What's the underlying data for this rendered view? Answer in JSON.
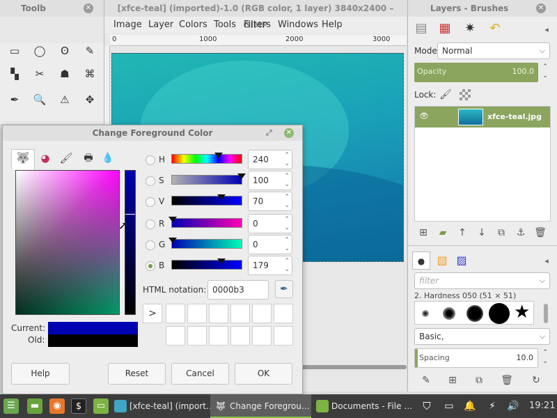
{
  "toolbox": {
    "title": "Toolb",
    "tools": [
      {
        "icon": "rect-select-icon",
        "glyph": "▭"
      },
      {
        "icon": "ellipse-select-icon",
        "glyph": "◯"
      },
      {
        "icon": "lasso-select-icon",
        "glyph": "ʘ"
      },
      {
        "icon": "fuzzy-select-icon",
        "glyph": "✎"
      },
      {
        "icon": "color-select-icon",
        "glyph": "▚"
      },
      {
        "icon": "scissors-select-icon",
        "glyph": "✂"
      },
      {
        "icon": "foreground-select-icon",
        "glyph": "☗"
      },
      {
        "icon": "paths-tool-icon",
        "glyph": "⌘"
      },
      {
        "icon": "color-picker-icon",
        "glyph": "✒"
      },
      {
        "icon": "zoom-tool-icon",
        "glyph": "🔍"
      },
      {
        "icon": "measure-tool-icon",
        "glyph": "⚠"
      },
      {
        "icon": "move-tool-icon",
        "glyph": "✥"
      }
    ]
  },
  "image_window": {
    "title": "[xfce-teal] (imported)-1.0 (RGB color, 1 layer) 3840x2400 – GIMP",
    "menu": [
      "Image",
      "Layer",
      "Colors",
      "Tools",
      "Filters",
      "Windows",
      "Help"
    ],
    "ruler_ticks": [
      "0",
      "1000",
      "2000",
      "3000"
    ]
  },
  "dock": {
    "title": "Layers - Brushes",
    "mode_label": "Mode:",
    "mode_value": "Normal",
    "opacity_label": "Opacity",
    "opacity_value": "100.0",
    "lock_label": "Lock:",
    "layer_name": "xfce-teal.jpg",
    "filter_placeholder": "filter",
    "brush_name": "2. Hardness 050 (51 × 51)",
    "brush_preset": "Basic,",
    "spacing_label": "Spacing",
    "spacing_value": "10.0"
  },
  "color_dialog": {
    "title": "Change Foreground Color",
    "channels": [
      {
        "label": "H",
        "value": "240"
      },
      {
        "label": "S",
        "value": "100"
      },
      {
        "label": "V",
        "value": "70"
      },
      {
        "label": "R",
        "value": "0"
      },
      {
        "label": "G",
        "value": "0"
      },
      {
        "label": "B",
        "value": "179"
      }
    ],
    "selected_channel": "B",
    "html_label": "HTML notation:",
    "html_value": "0000b3",
    "current_label": "Current:",
    "old_label": "Old:",
    "current_color": "#0000b3",
    "old_color": "#000000",
    "history_arrow": ">",
    "buttons": {
      "help": "Help",
      "reset": "Reset",
      "cancel": "Cancel",
      "ok": "OK"
    }
  },
  "taskbar": {
    "tasks": [
      {
        "label": "[xfce-teal] (import…"
      },
      {
        "label": "Change Foregrou…"
      },
      {
        "label": "Documents - File …"
      }
    ],
    "clock": "19:21"
  }
}
